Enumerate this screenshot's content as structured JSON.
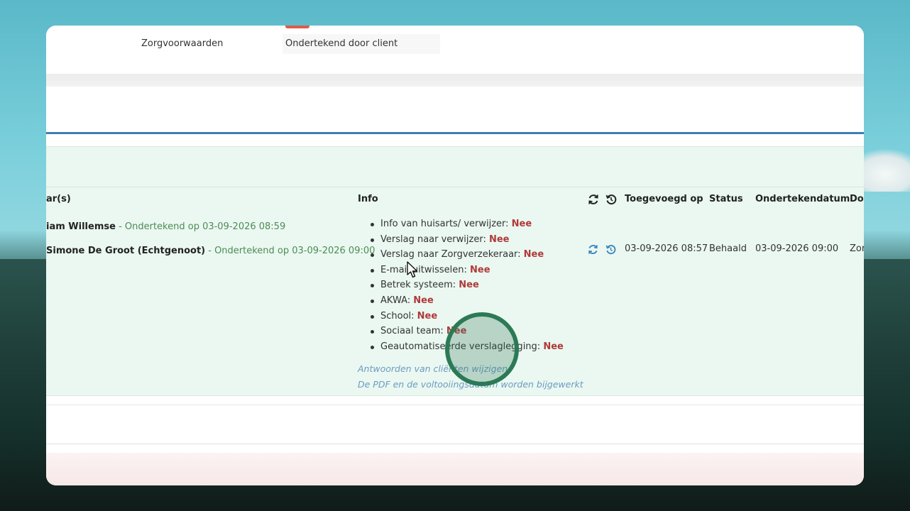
{
  "form": {
    "label": "Zorgvoorwaarden",
    "value": "Ondertekend door client"
  },
  "table": {
    "headers": {
      "signers": "ar(s)",
      "info": "Info",
      "added": "Toegevoegd op",
      "status": "Status",
      "signed_date": "Ondertekendatum",
      "doc": "Do"
    },
    "signers": [
      {
        "name": "iam Willemse",
        "signed": " - Ondertekend op 03-09-2026 08:59"
      },
      {
        "name": "Simone De Groot (Echtgenoot)",
        "signed": " - Ondertekend op 03-09-2026 09:00"
      }
    ],
    "info_items": [
      {
        "label": "Info van huisarts/ verwijzer: ",
        "value": "Nee"
      },
      {
        "label": "Verslag naar verwijzer: ",
        "value": "Nee"
      },
      {
        "label": "Verslag naar Zorgverzekeraar: ",
        "value": "Nee"
      },
      {
        "label": "E-mail uitwisselen: ",
        "value": "Nee"
      },
      {
        "label": "Betrek systeem: ",
        "value": "Nee"
      },
      {
        "label": "AKWA: ",
        "value": "Nee"
      },
      {
        "label": "School: ",
        "value": "Nee"
      },
      {
        "label": "Sociaal team: ",
        "value": "Nee"
      },
      {
        "label": "Geautomatiseerde verslaglegging: ",
        "value": "Nee"
      }
    ],
    "links": {
      "change_answers": "Antwoorden van cliënten wijzigen",
      "pdf_note": "De PDF en de voltooiingsdatum worden bijgewerkt"
    },
    "row": {
      "added": "03-09-2026 08:57",
      "status": "Behaald",
      "signed_date": "03-09-2026 09:00",
      "doc": "Zor"
    },
    "icons": [
      "refresh-icon",
      "history-icon"
    ]
  },
  "colors": {
    "accent_blue": "#3a7fb5",
    "panel_green": "#eaf8f1",
    "nee_red": "#b03a3a",
    "signed_green": "#4f8a55",
    "link_blue": "#6c9bc2"
  }
}
